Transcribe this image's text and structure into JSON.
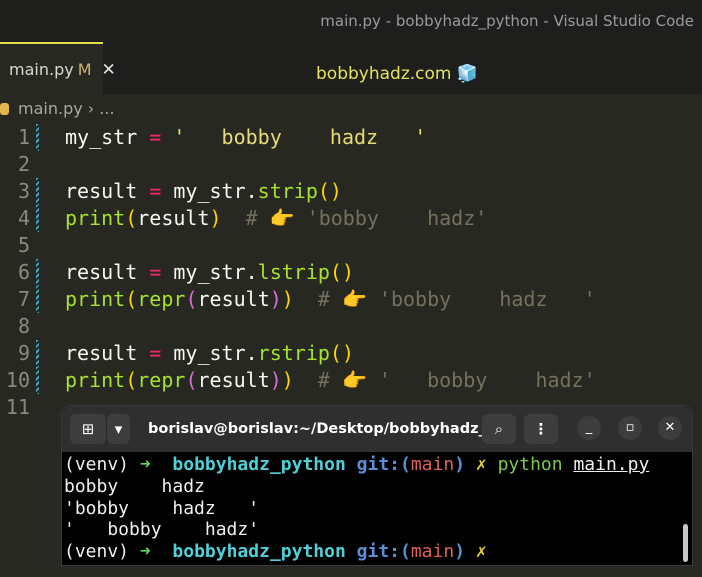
{
  "window": {
    "title": "main.py - bobbyhadz_python - Visual Studio Code"
  },
  "tab": {
    "label": "main.py",
    "modified": "M",
    "close": "✕"
  },
  "center_text": "bobbyhadz.com 🧊",
  "breadcrumb": {
    "file": "main.py",
    "sep": "›",
    "more": "..."
  },
  "code": [
    {
      "n": "1",
      "t": [
        [
          "",
          "my_str "
        ],
        [
          "op",
          "="
        ],
        [
          "st",
          " '   bobby    hadz   '"
        ]
      ]
    },
    {
      "n": "2",
      "t": []
    },
    {
      "n": "3",
      "t": [
        [
          "",
          "result "
        ],
        [
          "op",
          "="
        ],
        [
          "",
          " my_str."
        ],
        [
          "fn",
          "strip"
        ],
        [
          "p1",
          "()"
        ]
      ]
    },
    {
      "n": "4",
      "t": [
        [
          "fn",
          "print"
        ],
        [
          "p1",
          "("
        ],
        [
          "",
          "result"
        ],
        [
          "p1",
          ")"
        ],
        [
          "cm",
          "  # 👉 'bobby    hadz'"
        ]
      ]
    },
    {
      "n": "5",
      "t": []
    },
    {
      "n": "6",
      "t": [
        [
          "",
          "result "
        ],
        [
          "op",
          "="
        ],
        [
          "",
          " my_str."
        ],
        [
          "fn",
          "lstrip"
        ],
        [
          "p1",
          "()"
        ]
      ]
    },
    {
      "n": "7",
      "t": [
        [
          "fn",
          "print"
        ],
        [
          "p1",
          "("
        ],
        [
          "fn",
          "repr"
        ],
        [
          "p2",
          "("
        ],
        [
          "",
          "result"
        ],
        [
          "p2",
          ")"
        ],
        [
          "p1",
          ")"
        ],
        [
          "cm",
          "  # 👉 'bobby    hadz   '"
        ]
      ]
    },
    {
      "n": "8",
      "t": []
    },
    {
      "n": "9",
      "t": [
        [
          "",
          "result "
        ],
        [
          "op",
          "="
        ],
        [
          "",
          " my_str."
        ],
        [
          "fn",
          "rstrip"
        ],
        [
          "p1",
          "()"
        ]
      ]
    },
    {
      "n": "10",
      "t": [
        [
          "fn",
          "print"
        ],
        [
          "p1",
          "("
        ],
        [
          "fn",
          "repr"
        ],
        [
          "p2",
          "("
        ],
        [
          "",
          "result"
        ],
        [
          "p2",
          ")"
        ],
        [
          "p1",
          ")"
        ],
        [
          "cm",
          "  # 👉 '   bobby    hadz'"
        ]
      ]
    },
    {
      "n": "11",
      "t": []
    }
  ],
  "terminal": {
    "title": "borislav@borislav:~/Desktop/bobbyhadz_...",
    "prompt": {
      "venv": "(venv)",
      "arrow": "➜",
      "dir": "bobbyhadz_python",
      "git": "git:(",
      "branch": "main",
      "git_close": ")",
      "dirty": "✗"
    },
    "command": "python",
    "arg": "main.py",
    "output": [
      "bobby    hadz",
      "'bobby    hadz   '",
      "'   bobby    hadz'"
    ]
  },
  "colors": {
    "accent": "#e2e24a",
    "terminal_bg": "#000000",
    "editor_bg": "#272822"
  }
}
